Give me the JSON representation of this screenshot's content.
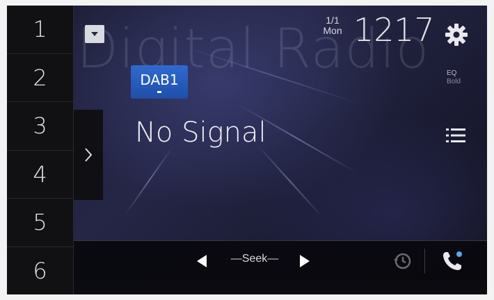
{
  "background_title": "Digital Radio",
  "presets": [
    {
      "label": "1"
    },
    {
      "label": "2"
    },
    {
      "label": "3"
    },
    {
      "label": "4"
    },
    {
      "label": "5"
    },
    {
      "label": "6"
    }
  ],
  "band": {
    "label": "DAB1"
  },
  "station": {
    "name": "No Signal"
  },
  "clock": {
    "date": "1/1",
    "weekday": "Mon",
    "hour": "12",
    "minute": "17"
  },
  "eq": {
    "label": "EQ",
    "value": "Bold"
  },
  "controls": {
    "seek_label": "Seek"
  },
  "icons": {
    "dropdown": "chevron-down-icon",
    "expand": "chevron-right-icon",
    "settings": "gear-icon",
    "list": "list-icon",
    "seek_prev": "triangle-left-icon",
    "seek_next": "triangle-right-icon",
    "history": "clock-history-icon",
    "phone": "phone-icon"
  },
  "colors": {
    "badge": "#2f6ad0",
    "preset_bg": "#111114",
    "phone_accent": "#5aa7f0"
  }
}
